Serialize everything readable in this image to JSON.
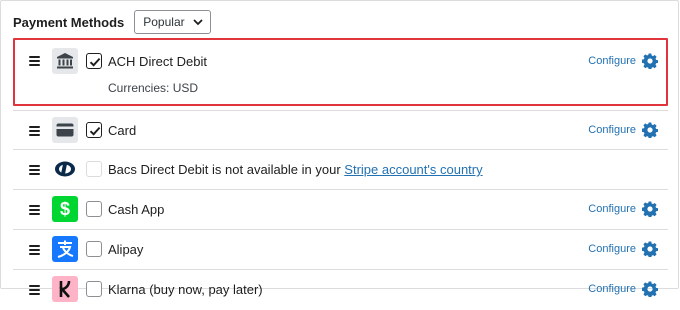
{
  "header": {
    "title": "Payment Methods",
    "filter": {
      "selected": "Popular"
    }
  },
  "methods": [
    {
      "name": "ACH Direct Debit",
      "checked": true,
      "configure": "Configure",
      "currencies": "Currencies: USD",
      "icon": "bank-icon",
      "highlighted": true
    },
    {
      "name": "Card",
      "checked": true,
      "configure": "Configure",
      "icon": "card-icon"
    },
    {
      "name_prefix": "Bacs Direct Debit is not available in your",
      "link_text": "Stripe account's country",
      "checked": false,
      "disabled": true,
      "icon": "bacs-icon"
    },
    {
      "name": "Cash App",
      "checked": false,
      "configure": "Configure",
      "icon": "cash-app-icon"
    },
    {
      "name": "Alipay",
      "checked": false,
      "configure": "Configure",
      "icon": "alipay-icon"
    },
    {
      "name": "Klarna (buy now, pay later)",
      "checked": false,
      "configure": "Configure",
      "icon": "klarna-icon"
    }
  ],
  "colors": {
    "accent": "#2271b1",
    "highlight_border": "#e0353d",
    "cash_app": "#00d632",
    "alipay": "#1677ff",
    "klarna": "#ffb3c7"
  }
}
